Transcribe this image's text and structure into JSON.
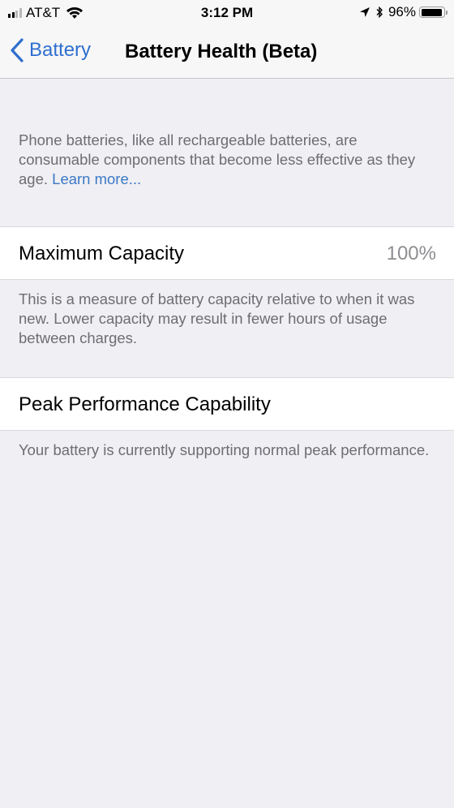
{
  "status_bar": {
    "carrier": "AT&T",
    "time": "3:12 PM",
    "battery_percent": "96%",
    "battery_level": 0.96,
    "signal_bars_filled": 2,
    "signal_bars_total": 4,
    "icons": [
      "signal-icon",
      "wifi-icon",
      "location-arrow-icon",
      "bluetooth-icon",
      "battery-icon"
    ]
  },
  "nav": {
    "back_label": "Battery",
    "title": "Battery Health (Beta)",
    "accent_color": "#2f6fcf"
  },
  "intro": {
    "text": "Phone batteries, like all rechargeable batteries, are consumable components that become less effective as they age.",
    "link": "Learn more..."
  },
  "sections": [
    {
      "label": "Maximum Capacity",
      "value": "100%",
      "footer": "This is a measure of battery capacity relative to when it was new. Lower capacity may result in fewer hours of usage between charges."
    },
    {
      "label": "Peak Performance Capability",
      "value": "",
      "footer": "Your battery is currently supporting normal peak performance."
    }
  ]
}
